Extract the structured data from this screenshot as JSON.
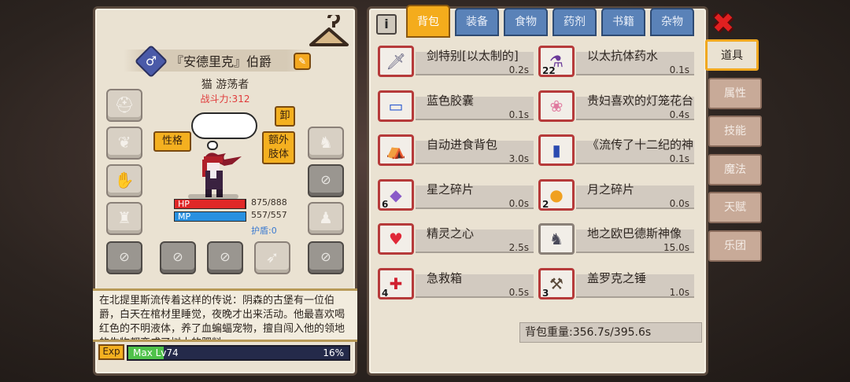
{
  "character": {
    "name": "『安德里克』伯爵",
    "gender_symbol": "♂",
    "race_title": "猫 游荡者",
    "power_label": "战斗力:312",
    "personality_button": "性格",
    "unequip_button": "卸",
    "extra_limbs_button": "额外\n肢体",
    "hp_label": "HP",
    "hp_value": "875/888",
    "hp_fraction": 0.985,
    "mp_label": "MP",
    "mp_value": "557/557",
    "mp_fraction": 1.0,
    "shield_label": "护盾:0",
    "description": "在北提里斯流传着这样的传说：阴森的古堡有一位伯爵，白天在棺材里睡觉，夜晚才出来活动。他最喜欢喝红色的不明液体，养了血蝙蝠宠物，擅自闯入他的领地的生物都变成了树木的肥料",
    "exp_label": "Exp",
    "level_text": "Max Lv74",
    "exp_percent_text": "16%",
    "exp_fraction": 0.16
  },
  "inventory_tabs": [
    "背包",
    "装备",
    "食物",
    "药剂",
    "书籍",
    "杂物"
  ],
  "active_tab": "背包",
  "items_left": [
    {
      "name": "剑特别[以太制的]",
      "weight": "0.2s",
      "count": "",
      "icon": "sword-icon",
      "rare": true
    },
    {
      "name": "蓝色胶囊",
      "weight": "0.1s",
      "count": "",
      "icon": "capsule-icon",
      "rare": true
    },
    {
      "name": "自动进食背包",
      "weight": "3.0s",
      "count": "",
      "icon": "backpack-icon",
      "rare": true
    },
    {
      "name": "星之碎片",
      "weight": "0.0s",
      "count": "6",
      "icon": "crystal-icon",
      "rare": true
    },
    {
      "name": "精灵之心",
      "weight": "2.5s",
      "count": "",
      "icon": "heart-icon",
      "rare": true
    },
    {
      "name": "急救箱",
      "weight": "0.5s",
      "count": "4",
      "icon": "first-aid-icon",
      "rare": true
    }
  ],
  "items_right": [
    {
      "name": "以太抗体药水",
      "weight": "0.1s",
      "count": "22",
      "icon": "potion-icon",
      "rare": true
    },
    {
      "name": "贵妇喜欢的灯笼花台",
      "weight": "0.4s",
      "count": "",
      "icon": "lantern-flower-icon",
      "rare": true
    },
    {
      "name": "《流传了十二纪的神",
      "weight": "0.1s",
      "count": "",
      "icon": "book-icon",
      "rare": true
    },
    {
      "name": "月之碎片",
      "weight": "0.0s",
      "count": "2",
      "icon": "moon-shard-icon",
      "rare": true
    },
    {
      "name": "地之欧巴德斯神像",
      "weight": "15.0s",
      "count": "",
      "icon": "statue-icon",
      "rare": false
    },
    {
      "name": "盖罗克之锤",
      "weight": "1.0s",
      "count": "3",
      "icon": "hammer-icon",
      "rare": true
    }
  ],
  "bag_weight": "背包重量:356.7s/395.6s",
  "side_tabs": [
    "道具",
    "属性",
    "技能",
    "魔法",
    "天赋",
    "乐团"
  ],
  "active_side_tab": "道具",
  "colors": {
    "accent": "#f4ac1c",
    "tab_blue": "#5a82b8",
    "hp": "#e02828",
    "mp": "#2890e0",
    "rare_border": "#b63a3a"
  }
}
